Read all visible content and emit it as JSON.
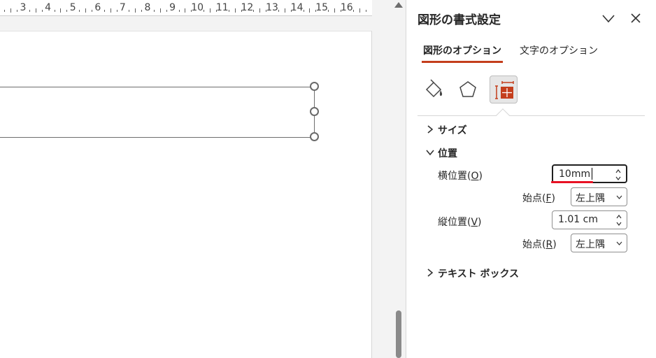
{
  "ruler": {
    "numbers": [
      "3",
      "4",
      "5",
      "6",
      "7",
      "8",
      "9",
      "10",
      "11",
      "12",
      "13",
      "14",
      "15",
      "16"
    ]
  },
  "pane": {
    "title": "図形の書式設定",
    "tabs": {
      "shape_options": "図形のオプション",
      "text_options": "文字のオプション"
    },
    "icons": [
      "fill-line-icon",
      "effects-pentagon-icon",
      "size-properties-icon"
    ],
    "sections": {
      "size": "サイズ",
      "position": "位置",
      "textbox": "テキスト ボックス"
    },
    "position": {
      "horizontal_label": "横位置(",
      "horizontal_accel": "O",
      "horizontal_value": "10mm",
      "horizontal_from_label": "始点(",
      "horizontal_from_accel": "F",
      "horizontal_from_value": "左上隅",
      "vertical_label": "縦位置(",
      "vertical_accel": "V",
      "vertical_value": "1.01 cm",
      "vertical_from_label": "始点(",
      "vertical_from_accel": "R",
      "vertical_from_value": "左上隅",
      "close_paren": ")"
    }
  },
  "colors": {
    "accent": "#c43e1c",
    "spell_error": "#e81123"
  }
}
